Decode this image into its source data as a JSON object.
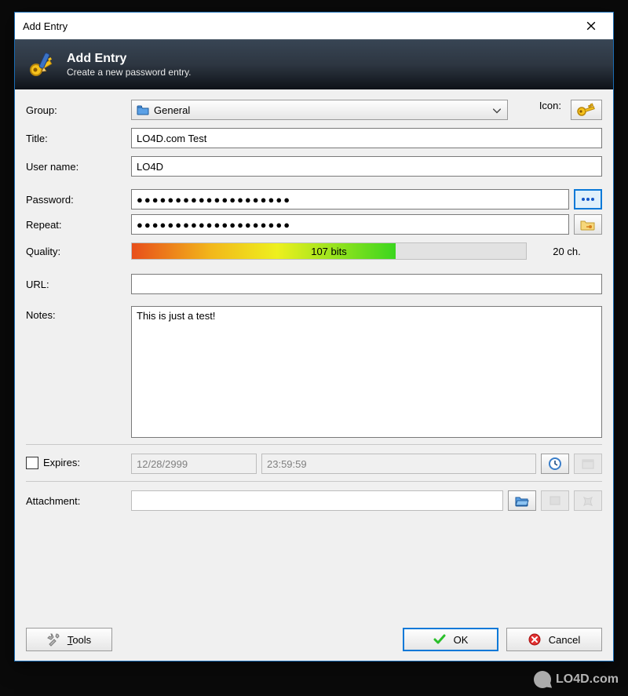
{
  "window": {
    "title": "Add Entry"
  },
  "banner": {
    "heading": "Add Entry",
    "subtitle": "Create a new password entry."
  },
  "icons": {
    "close": "close-icon",
    "key": "key-icon",
    "folder": "folder-icon",
    "dots": "dots-icon",
    "folderkey": "folder-key-icon",
    "clock": "clock-icon",
    "openfolder": "open-folder-icon",
    "attachview": "attach-view-icon",
    "attachdelete": "attach-delete-icon",
    "tools": "tools-icon",
    "check": "check-icon",
    "cancel": "cancel-icon",
    "calendar": "calendar-disabled-icon"
  },
  "form": {
    "group_label": "Group:",
    "group_value": "General",
    "icon_label": "Icon:",
    "title_label": "Title:",
    "title_value": "LO4D.com Test",
    "username_label": "User name:",
    "username_value": "LO4D",
    "password_label": "Password:",
    "password_mask": "●●●●●●●●●●●●●●●●●●●●",
    "repeat_label": "Repeat:",
    "repeat_mask": "●●●●●●●●●●●●●●●●●●●●",
    "quality_label": "Quality:",
    "quality_bits": "107 bits",
    "quality_chars": "20 ch.",
    "url_label": "URL:",
    "url_value": "",
    "notes_label": "Notes:",
    "notes_value": "This is just a test!",
    "expires_label": "Expires:",
    "expires_date": "12/28/2999",
    "expires_time": "23:59:59",
    "attachment_label": "Attachment:",
    "attachment_value": ""
  },
  "footer": {
    "tools": "Tools",
    "ok": "OK",
    "cancel": "Cancel"
  },
  "watermark": "LO4D.com"
}
